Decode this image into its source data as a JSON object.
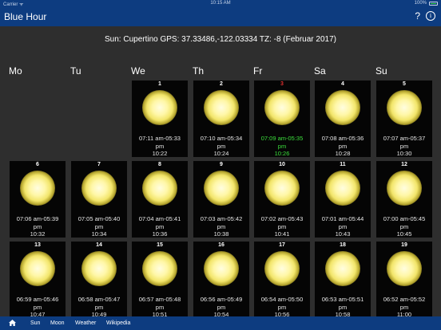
{
  "status": {
    "carrier": "Carrier ᯤ",
    "time": "10:15 AM",
    "battery": "100%",
    "battery_level": 1.0
  },
  "nav": {
    "title": "Blue Hour",
    "help": "?",
    "info": "i"
  },
  "sun_info": "Sun: Cupertino GPS: 37.33486,-122.03334 TZ: -8 (Februar 2017)",
  "weekdays": [
    "Mo",
    "Tu",
    "We",
    "Th",
    "Fr",
    "Sa",
    "Su"
  ],
  "days": [
    {
      "day": "1",
      "rise": "07:11 am-05:33",
      "pm": "pm",
      "dur": "10:22"
    },
    {
      "day": "2",
      "rise": "07:10 am-05:34",
      "pm": "pm",
      "dur": "10:24"
    },
    {
      "day": "3",
      "rise": "07:09 am-05:35",
      "pm": "pm",
      "dur": "10:26",
      "today": true
    },
    {
      "day": "4",
      "rise": "07:08 am-05:36",
      "pm": "pm",
      "dur": "10:28"
    },
    {
      "day": "5",
      "rise": "07:07 am-05:37",
      "pm": "pm",
      "dur": "10:30"
    },
    {
      "day": "6",
      "rise": "07:06 am-05:39",
      "pm": "pm",
      "dur": "10:32"
    },
    {
      "day": "7",
      "rise": "07:05 am-05:40",
      "pm": "pm",
      "dur": "10:34"
    },
    {
      "day": "8",
      "rise": "07:04 am-05:41",
      "pm": "pm",
      "dur": "10:36"
    },
    {
      "day": "9",
      "rise": "07:03 am-05:42",
      "pm": "pm",
      "dur": "10:38"
    },
    {
      "day": "10",
      "rise": "07:02 am-05:43",
      "pm": "pm",
      "dur": "10:41"
    },
    {
      "day": "11",
      "rise": "07:01 am-05:44",
      "pm": "pm",
      "dur": "10:43"
    },
    {
      "day": "12",
      "rise": "07:00 am-05:45",
      "pm": "pm",
      "dur": "10:45"
    },
    {
      "day": "13",
      "rise": "06:59 am-05:46",
      "pm": "pm",
      "dur": "10:47"
    },
    {
      "day": "14",
      "rise": "06:58 am-05:47",
      "pm": "pm",
      "dur": "10:49"
    },
    {
      "day": "15",
      "rise": "06:57 am-05:48",
      "pm": "pm",
      "dur": "10:51"
    },
    {
      "day": "16",
      "rise": "06:56 am-05:49",
      "pm": "pm",
      "dur": "10:54"
    },
    {
      "day": "17",
      "rise": "06:54 am-05:50",
      "pm": "pm",
      "dur": "10:56"
    },
    {
      "day": "18",
      "rise": "06:53 am-05:51",
      "pm": "pm",
      "dur": "10:58"
    },
    {
      "day": "19",
      "rise": "06:52 am-05:52",
      "pm": "pm",
      "dur": "11:00"
    }
  ],
  "first_weekday_index": 2,
  "tabs": {
    "sun": "Sun",
    "moon": "Moon",
    "weather": "Weather",
    "wikipedia": "Wikipedia"
  },
  "colors": {
    "nav_bg": "#0d3c80",
    "today": "#3ce03c",
    "today_number": "#e03030"
  }
}
